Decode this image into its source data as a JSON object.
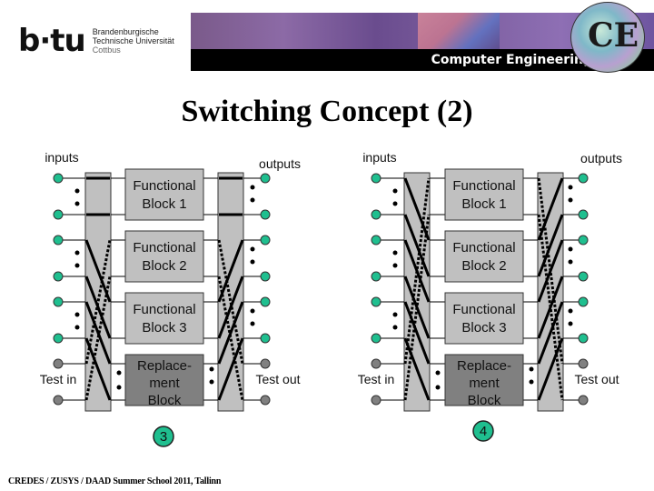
{
  "header": {
    "logo_mark": "b·tu",
    "university_lines": [
      "Brandenburgische",
      "Technische Universität",
      "Cottbus"
    ],
    "banner_title": "Computer Engineering",
    "badge_text": "CE"
  },
  "page_title": "Switching Concept (2)",
  "footer": "CREDES / ZUSYS / DAAD Summer School 2011, Tallinn",
  "colors": {
    "port_active": "#1fbf8f",
    "port_test": "#808080",
    "switch_fill": "#c0c0c0",
    "block_fill": "#c0c0c0",
    "replacement_fill": "#808080",
    "badge_fill": "#1fbf8f"
  },
  "diagrams": [
    {
      "id": "config-3",
      "inputs_label": "inputs",
      "outputs_label": "outputs",
      "test_in_label": "Test in",
      "test_out_label": "Test out",
      "badge": "3",
      "routing": "direct",
      "blocks": [
        {
          "line1": "Functional",
          "line2": "Block 1",
          "type": "functional"
        },
        {
          "line1": "Functional",
          "line2": "Block 2",
          "type": "functional"
        },
        {
          "line1": "Functional",
          "line2": "Block 3",
          "type": "functional"
        },
        {
          "line1": "Replace-",
          "line2": "ment",
          "line3": "Block",
          "type": "replacement"
        }
      ]
    },
    {
      "id": "config-4",
      "inputs_label": "inputs",
      "outputs_label": "outputs",
      "test_in_label": "Test in",
      "test_out_label": "Test out",
      "badge": "4",
      "routing": "shifted",
      "blocks": [
        {
          "line1": "Functional",
          "line2": "Block 1",
          "type": "functional"
        },
        {
          "line1": "Functional",
          "line2": "Block 2",
          "type": "functional"
        },
        {
          "line1": "Functional",
          "line2": "Block 3",
          "type": "functional"
        },
        {
          "line1": "Replace-",
          "line2": "ment",
          "line3": "Block",
          "type": "replacement"
        }
      ]
    }
  ]
}
